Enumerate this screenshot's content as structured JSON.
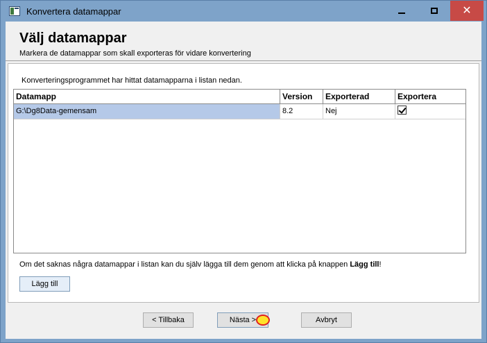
{
  "window": {
    "title": "Konvertera datamappar",
    "minimize_icon": "minimize-icon",
    "maximize_icon": "maximize-icon",
    "close_icon": "close-icon"
  },
  "header": {
    "title": "Välj datamappar",
    "subtitle": "Markera de datamappar som skall  exporteras för vidare konvertering"
  },
  "panel": {
    "info_text": "Konverteringsprogrammet har hittat datamapparna i listan nedan.",
    "columns": [
      "Datamapp",
      "Version",
      "Exporterad",
      "Exportera"
    ],
    "rows": [
      {
        "datamapp": "G:\\Dg8Data-gemensam",
        "version": "8.2",
        "exporterad": "Nej",
        "exportera": true
      }
    ],
    "missing_text_prefix": "Om det saknas några datamappar i listan kan du själv lägga till dem genom att klicka på knappen ",
    "missing_text_bold": "Lägg till",
    "missing_text_suffix": "!",
    "add_button": "Lägg till"
  },
  "footer": {
    "back_button": "< Tillbaka",
    "next_button": "Nästa >",
    "cancel_button": "Avbryt"
  }
}
